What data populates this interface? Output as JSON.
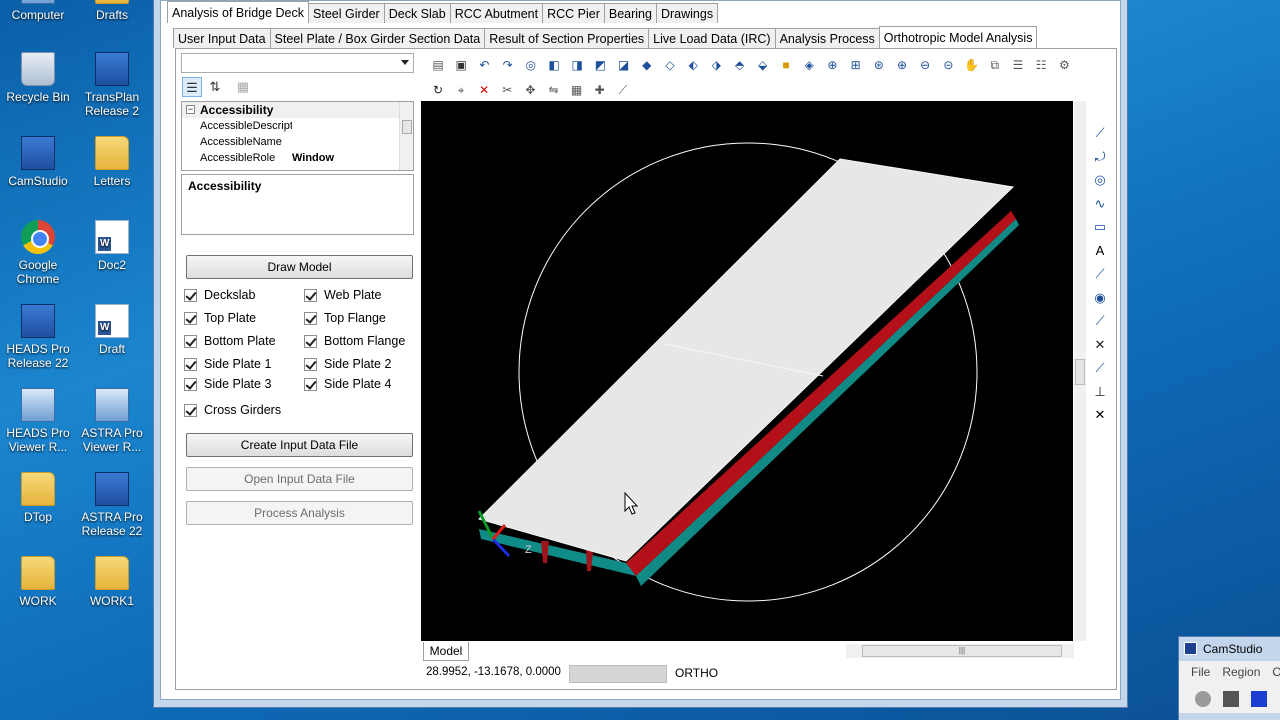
{
  "desktop": {
    "icons": [
      {
        "label": "Computer",
        "kind": "app2"
      },
      {
        "label": "Drafts",
        "kind": "folder"
      },
      {
        "label": "Recycle Bin",
        "kind": "bin"
      },
      {
        "label": "TransPlan Release 2",
        "kind": "app"
      },
      {
        "label": "CamStudio",
        "kind": "app"
      },
      {
        "label": "Letters",
        "kind": "folder"
      },
      {
        "label": "Google Chrome",
        "kind": "chrome"
      },
      {
        "label": "Doc2",
        "kind": "doc"
      },
      {
        "label": "HEADS Pro Release 22",
        "kind": "app"
      },
      {
        "label": "Draft",
        "kind": "doc"
      },
      {
        "label": "HEADS Pro Viewer R...",
        "kind": "app2"
      },
      {
        "label": "ASTRA Pro Viewer R...",
        "kind": "app2"
      },
      {
        "label": "DTop",
        "kind": "folder"
      },
      {
        "label": "ASTRA Pro Release 22",
        "kind": "app"
      },
      {
        "label": "WORK",
        "kind": "folder"
      },
      {
        "label": "WORK1",
        "kind": "folder"
      }
    ]
  },
  "tabs_main": [
    "Analysis of Bridge Deck",
    "Steel Girder",
    "Deck Slab",
    "RCC Abutment",
    "RCC Pier",
    "Bearing",
    "Drawings"
  ],
  "tabs_sub": [
    "User Input Data",
    "Steel Plate / Box Girder Section Data",
    "Result of Section Properties",
    "Live Load Data (IRC)",
    "Analysis Process",
    "Orthotropic Model Analysis"
  ],
  "propgrid": {
    "category": "Accessibility",
    "rows": [
      {
        "key": "AccessibleDescript",
        "value": ""
      },
      {
        "key": "AccessibleName",
        "value": ""
      },
      {
        "key": "AccessibleRole",
        "value": "Window"
      }
    ],
    "description_title": "Accessibility"
  },
  "buttons": {
    "draw_model": "Draw Model",
    "create_input": "Create Input Data File",
    "open_input": "Open Input Data File",
    "process_analysis": "Process Analysis"
  },
  "checkboxes": {
    "deckslab": "Deckslab",
    "web_plate": "Web Plate",
    "top_plate": "Top Plate",
    "top_flange": "Top Flange",
    "bottom_plate": "Bottom Plate",
    "bottom_flange": "Bottom Flange",
    "side_plate_1": "Side Plate 1",
    "side_plate_2": "Side Plate 2",
    "side_plate_3": "Side Plate 3",
    "side_plate_4": "Side Plate 4",
    "cross_girders": "Cross Girders"
  },
  "viewport": {
    "tab": "Model",
    "coordinates": "28.9952, -13.1678, 0.0000",
    "mode": "ORTHO",
    "axis_label": "Z"
  },
  "camstudio": {
    "title": "CamStudio",
    "menu": [
      "File",
      "Region",
      "O"
    ]
  }
}
